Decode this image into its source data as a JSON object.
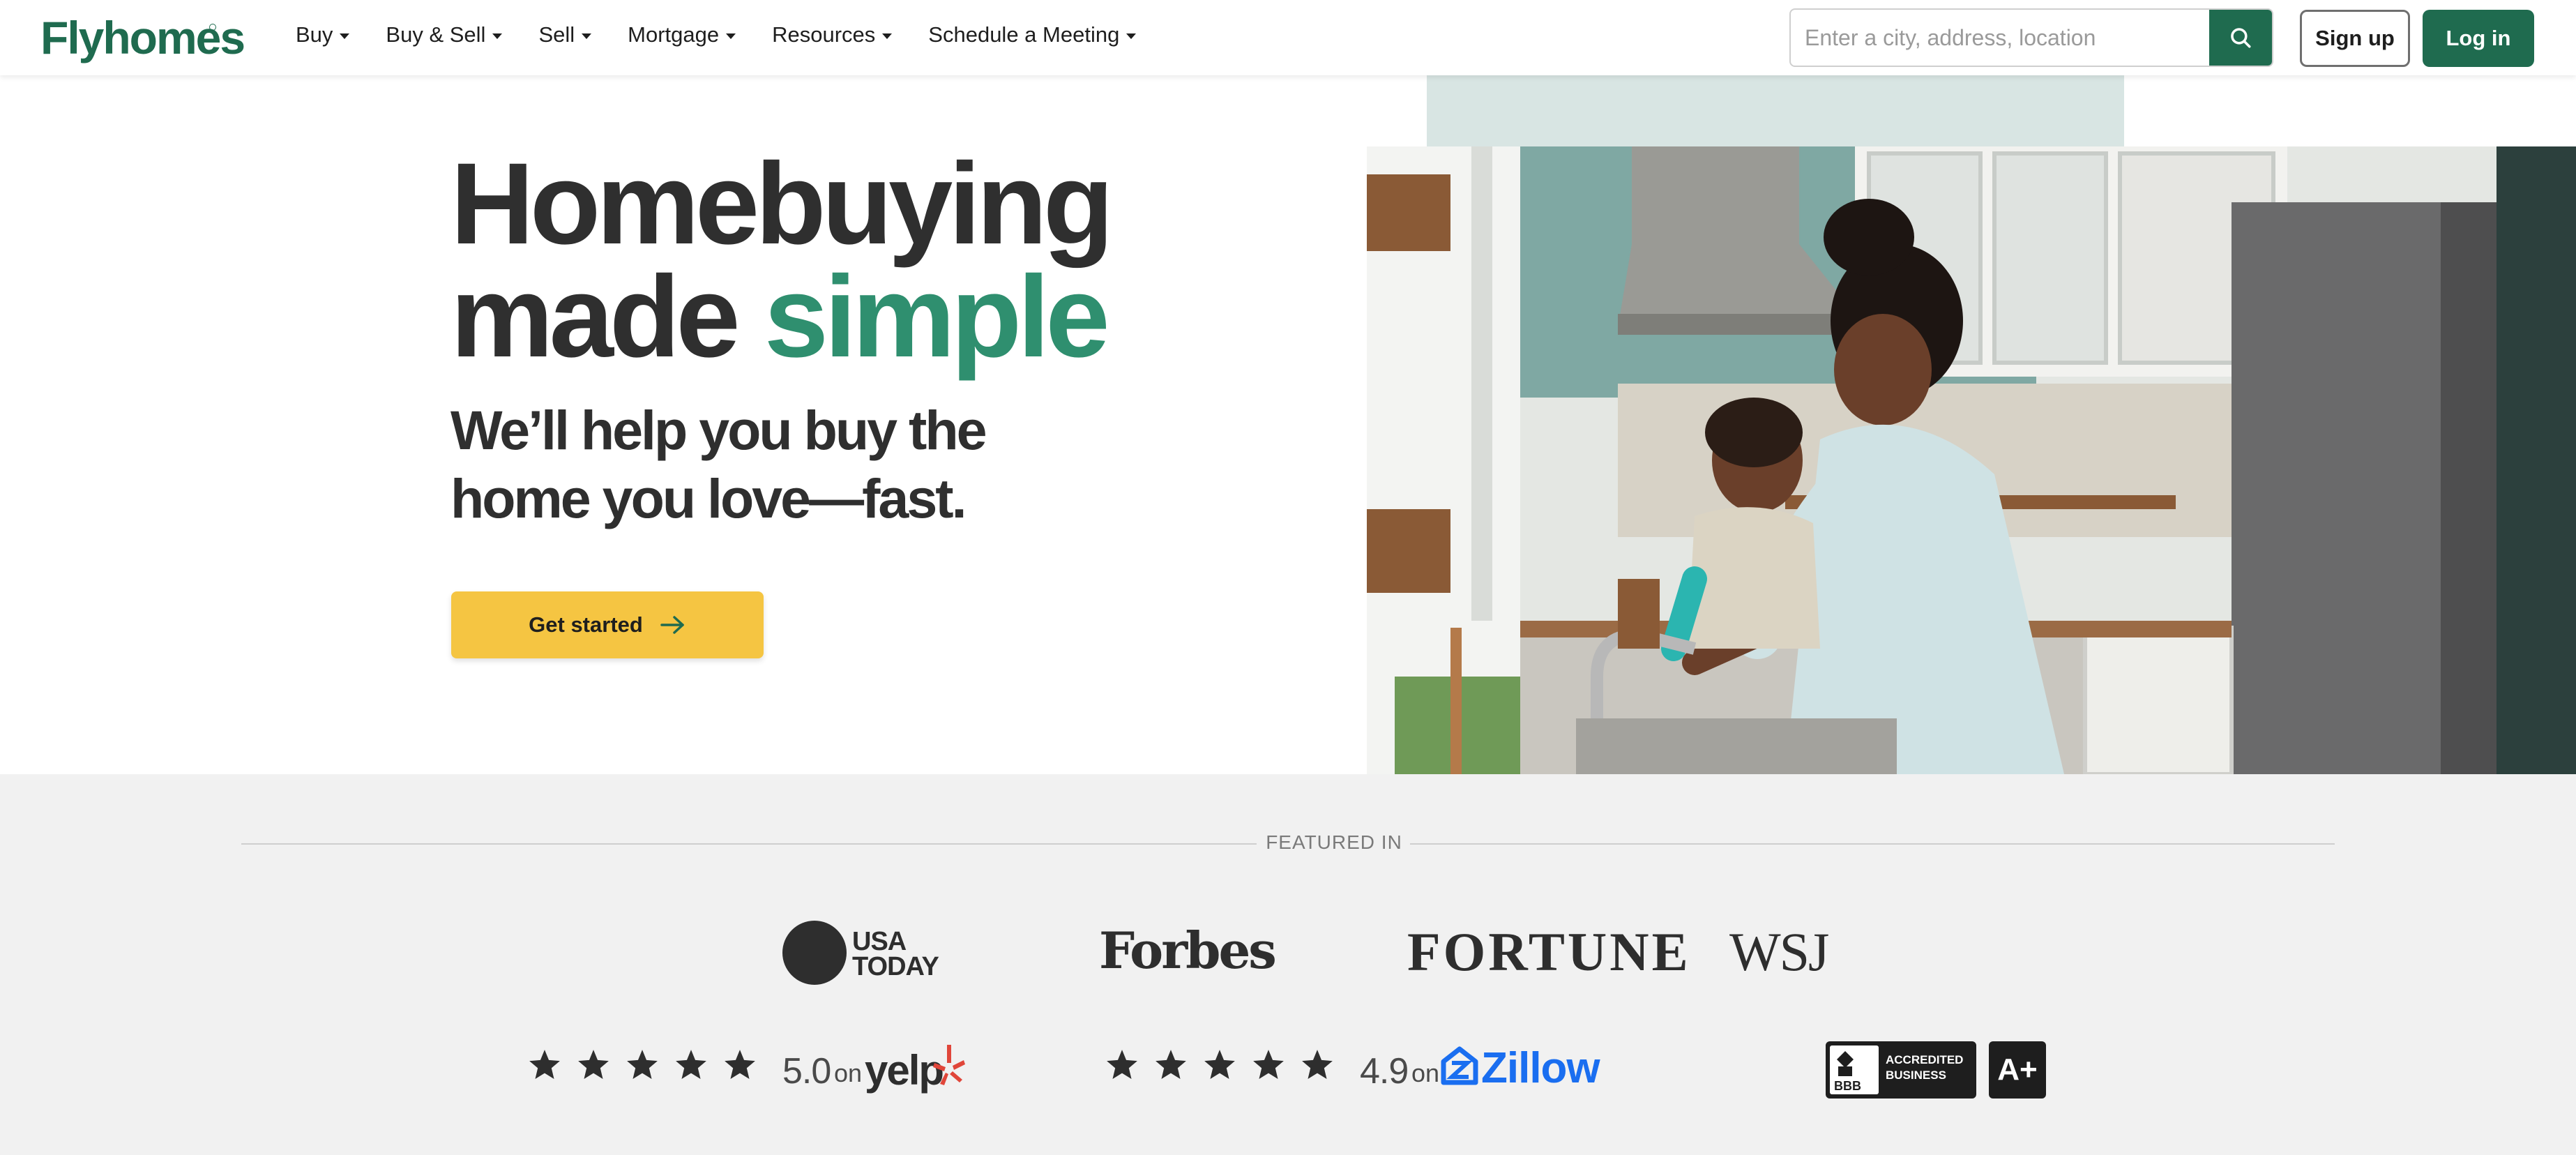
{
  "header": {
    "logo": "Flyhomes",
    "nav": [
      {
        "label": "Buy"
      },
      {
        "label": "Buy & Sell"
      },
      {
        "label": "Sell"
      },
      {
        "label": "Mortgage"
      },
      {
        "label": "Resources"
      },
      {
        "label": "Schedule a Meeting"
      }
    ],
    "search_placeholder": "Enter a city, address, location",
    "signup_label": "Sign up",
    "login_label": "Log in"
  },
  "hero": {
    "title_line1": "Homebuying",
    "title_line2_a": "made",
    "title_line2_b": "simple",
    "subtitle_line1": "We’ll help you buy the",
    "subtitle_line2": "home you love—fast.",
    "cta_label": "Get started",
    "image_icon": "kitchen-photo"
  },
  "featured": {
    "label": "FEATURED IN",
    "logos": [
      "USA TODAY",
      "Forbes",
      "FORTUNE",
      "WSJ"
    ],
    "usa_today_line1": "USA",
    "usa_today_line2": "TODAY"
  },
  "ratings": {
    "yelp": {
      "stars": 5,
      "score": "5.0",
      "on": "on",
      "brand": "yelp"
    },
    "zillow": {
      "stars": 5,
      "score": "4.9",
      "on": "on",
      "brand": "Zillow"
    },
    "bbb": {
      "label_line1": "ACCREDITED",
      "label_line2": "BUSINESS",
      "mark": "BBB",
      "grade": "A+"
    }
  },
  "colors": {
    "brand_green": "#1f6b4f",
    "accent_green": "#2f8f6f",
    "cta_yellow": "#f5c542",
    "zillow_blue": "#1a6ef0",
    "yelp_red": "#e0463a"
  }
}
